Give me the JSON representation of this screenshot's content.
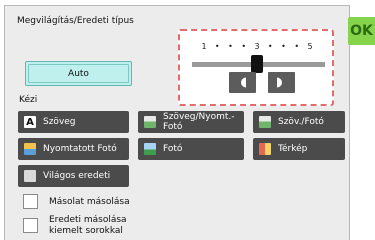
{
  "window": {
    "title": "Megvilágítás/Eredeti típus"
  },
  "ok_label": "OK",
  "auto_label": "Auto",
  "exposure": {
    "scale_labels": [
      "1",
      "•",
      "•",
      "•",
      "3",
      "•",
      "•",
      "•",
      "5"
    ],
    "value": 3,
    "min": 1,
    "max": 5
  },
  "manual": {
    "section_label": "Kézi",
    "buttons": [
      {
        "label": "Szöveg",
        "icon": "text-icon"
      },
      {
        "label": "Szöveg/Nyomt.-Fotó",
        "icon": "text-printed-photo-icon"
      },
      {
        "label": "Szöv./Fotó",
        "icon": "text-photo-icon"
      },
      {
        "label": "Nyomtatott Fotó",
        "icon": "printed-photo-icon"
      },
      {
        "label": "Fotó",
        "icon": "photo-icon"
      },
      {
        "label": "Térkép",
        "icon": "map-icon"
      },
      {
        "label": "Világos eredeti",
        "icon": "light-original-icon"
      }
    ]
  },
  "checkboxes": [
    {
      "label": "Másolat másolása",
      "checked": false
    },
    {
      "label": "Eredeti másolása kiemelt sorokkal",
      "checked": false
    }
  ]
}
